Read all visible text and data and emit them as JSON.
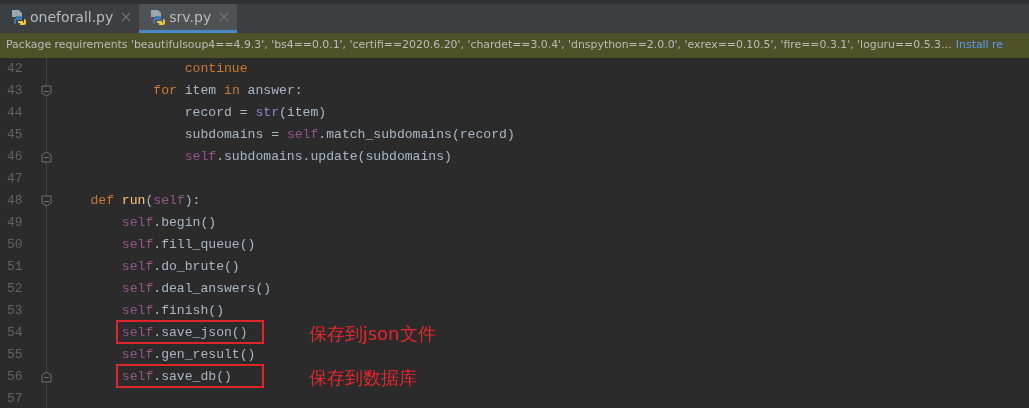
{
  "tabs": [
    {
      "label": "oneforall.py",
      "selected": false
    },
    {
      "label": "srv.py",
      "selected": true
    }
  ],
  "banner": {
    "message": "Package requirements 'beautifulsoup4==4.9.3', 'bs4==0.0.1', 'certifi==2020.6.20', 'chardet==3.0.4', 'dnspython==2.0.0', 'exrex==0.10.5', 'fire==0.3.1', 'loguru==0.5.3…",
    "link": "Install re"
  },
  "lines": [
    {
      "number": "42",
      "tokens": [
        {
          "kind": "keyword",
          "text": "                continue"
        }
      ]
    },
    {
      "number": "43",
      "fold_start": true,
      "tokens": [
        {
          "kind": "keyword",
          "text": "            for"
        },
        {
          "kind": "plain",
          "text": " item "
        },
        {
          "kind": "keyword",
          "text": "in"
        },
        {
          "kind": "plain",
          "text": " answer:"
        }
      ]
    },
    {
      "number": "44",
      "tokens": [
        {
          "kind": "plain",
          "text": "                record = "
        },
        {
          "kind": "builtin",
          "text": "str"
        },
        {
          "kind": "plain",
          "text": "(item)"
        }
      ]
    },
    {
      "number": "45",
      "tokens": [
        {
          "kind": "plain",
          "text": "                subdomains = "
        },
        {
          "kind": "self",
          "text": "self"
        },
        {
          "kind": "plain",
          "text": ".match_subdomains(record)"
        }
      ]
    },
    {
      "number": "46",
      "fold_end": true,
      "tokens": [
        {
          "kind": "self",
          "text": "                self"
        },
        {
          "kind": "plain",
          "text": ".subdomains.update(subdomains)"
        }
      ]
    },
    {
      "number": "47"
    },
    {
      "number": "48",
      "fold_start": true,
      "tokens": [
        {
          "kind": "keyword",
          "text": "    def"
        },
        {
          "kind": "func",
          "text": " run"
        },
        {
          "kind": "plain",
          "text": "("
        },
        {
          "kind": "self",
          "text": "self"
        },
        {
          "kind": "plain",
          "text": "):"
        }
      ]
    },
    {
      "number": "49",
      "tokens": [
        {
          "kind": "self",
          "text": "        self"
        },
        {
          "kind": "plain",
          "text": ".begin()"
        }
      ]
    },
    {
      "number": "50",
      "tokens": [
        {
          "kind": "self",
          "text": "        self"
        },
        {
          "kind": "plain",
          "text": ".fill_queue()"
        }
      ]
    },
    {
      "number": "51",
      "tokens": [
        {
          "kind": "self",
          "text": "        self"
        },
        {
          "kind": "plain",
          "text": ".do_brute()"
        }
      ]
    },
    {
      "number": "52",
      "tokens": [
        {
          "kind": "self",
          "text": "        self"
        },
        {
          "kind": "plain",
          "text": ".deal_answers()"
        }
      ]
    },
    {
      "number": "53",
      "tokens": [
        {
          "kind": "self",
          "text": "        self"
        },
        {
          "kind": "plain",
          "text": ".finish()"
        }
      ]
    },
    {
      "number": "54",
      "boxed": true,
      "note": "保存到json文件",
      "tokens": [
        {
          "kind": "self",
          "text": "        self"
        },
        {
          "kind": "plain",
          "text": ".save_json()"
        }
      ]
    },
    {
      "number": "55",
      "tokens": [
        {
          "kind": "self",
          "text": "        self"
        },
        {
          "kind": "plain",
          "text": ".gen_result()"
        }
      ]
    },
    {
      "number": "56",
      "fold_end": true,
      "boxed": true,
      "note": "保存到数据库",
      "tokens": [
        {
          "kind": "self",
          "text": "        self"
        },
        {
          "kind": "plain",
          "text": ".save_db()"
        }
      ]
    },
    {
      "number": "57"
    }
  ]
}
